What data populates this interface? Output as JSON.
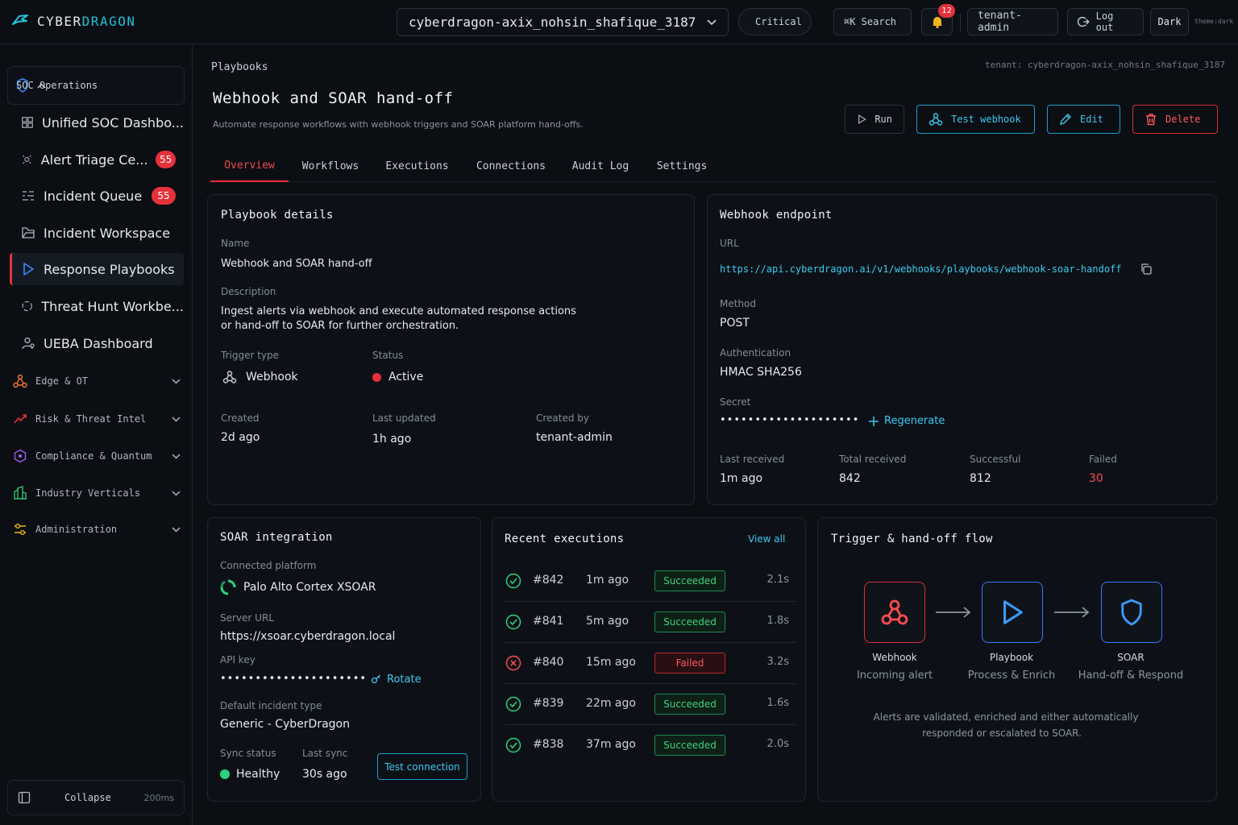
{
  "brand": {
    "name_a": "CYBER",
    "name_b": "DRAGON"
  },
  "topbar": {
    "tenant": "cyberdragon-axix_nohsin_shafique_3187",
    "severity": "Critical",
    "search": "⌘K Search",
    "notifications": "12",
    "user": "tenant-admin",
    "logout": "Log out",
    "theme": "Dark",
    "theme_note": "theme:dark"
  },
  "sidebar": {
    "section": "SOC Operations",
    "items": [
      {
        "label": "Unified SOC Dashbo...",
        "icon": "grid-icon"
      },
      {
        "label": "Alert Triage Ce...",
        "icon": "radar-icon",
        "badge": "55"
      },
      {
        "label": "Incident Queue",
        "icon": "list-icon",
        "badge": "55"
      },
      {
        "label": "Incident Workspace",
        "icon": "folder-icon"
      },
      {
        "label": "Response Playbooks",
        "icon": "play-icon"
      },
      {
        "label": "Threat Hunt Workbe...",
        "icon": "crosshair-icon"
      },
      {
        "label": "UEBA Dashboard",
        "icon": "user-icon"
      }
    ],
    "groups": [
      "Edge & OT",
      "Risk & Threat Intel",
      "Compliance & Quantum",
      "Industry Verticals",
      "Administration"
    ],
    "collapse": "Collapse",
    "collapse_time": "200ms"
  },
  "page": {
    "breadcrumb": "Playbooks",
    "tenant_note": "tenant: cyberdragon-axix_nohsin_shafique_3187",
    "title": "Webhook and SOAR hand-off",
    "subtitle": "Automate response workflows with webhook triggers and SOAR platform hand-offs.",
    "actions": {
      "run": "Run",
      "test": "Test webhook",
      "edit": "Edit",
      "delete": "Delete"
    },
    "tabs": [
      "Overview",
      "Workflows",
      "Executions",
      "Connections",
      "Audit Log",
      "Settings"
    ]
  },
  "details": {
    "title": "Playbook details",
    "name_label": "Name",
    "name": "Webhook and SOAR hand-off",
    "desc_label": "Description",
    "desc_1": "Ingest alerts via webhook and execute automated response actions",
    "desc_2": "or hand-off to SOAR for further orchestration.",
    "trigger_label": "Trigger type",
    "trigger": "Webhook",
    "status_label": "Status",
    "status": "Active",
    "created_label": "Created",
    "created": "2d ago",
    "updated_label": "Last updated",
    "updated": "1h ago",
    "by_label": "Created by",
    "by": "tenant-admin"
  },
  "webhook": {
    "title": "Webhook endpoint",
    "url_label": "URL",
    "url": "https://api.cyberdragon.ai/v1/webhooks/playbooks/webhook-soar-handoff",
    "method_label": "Method",
    "method": "POST",
    "auth_label": "Authentication",
    "auth": "HMAC SHA256",
    "secret_label": "Secret",
    "secret": "••••••••••••••••••••",
    "regenerate": "Regenerate",
    "last_label": "Last received",
    "last": "1m ago",
    "total_label": "Total received",
    "total": "842",
    "success_label": "Successful",
    "success": "812",
    "failed_label": "Failed",
    "failed": "30"
  },
  "soar": {
    "title": "SOAR integration",
    "platform_label": "Connected platform",
    "platform": "Palo Alto Cortex XSOAR",
    "server_label": "Server URL",
    "server": "https://xsoar.cyberdragon.local",
    "key_label": "API key",
    "key": "•••••••••••••••••••••",
    "rotate": "Rotate",
    "incident_label": "Default incident type",
    "incident": "Generic - CyberDragon",
    "sync_label": "Sync status",
    "sync": "Healthy",
    "lastsync_label": "Last sync",
    "lastsync": "30s ago",
    "test": "Test connection"
  },
  "executions": {
    "title": "Recent executions",
    "view_all": "View all",
    "rows": [
      {
        "id": "#842",
        "time": "1m ago",
        "status": "Succeeded",
        "dur": "2.1s",
        "ok": true
      },
      {
        "id": "#841",
        "time": "5m ago",
        "status": "Succeeded",
        "dur": "1.8s",
        "ok": true
      },
      {
        "id": "#840",
        "time": "15m ago",
        "status": "Failed",
        "dur": "3.2s",
        "ok": false
      },
      {
        "id": "#839",
        "time": "22m ago",
        "status": "Succeeded",
        "dur": "1.6s",
        "ok": true
      },
      {
        "id": "#838",
        "time": "37m ago",
        "status": "Succeeded",
        "dur": "2.0s",
        "ok": true
      }
    ]
  },
  "flow": {
    "title": "Trigger & hand-off flow",
    "steps": [
      {
        "name": "Webhook",
        "sub": "Incoming alert"
      },
      {
        "name": "Playbook",
        "sub": "Process & Enrich"
      },
      {
        "name": "SOAR",
        "sub": "Hand-off & Respond"
      }
    ],
    "note_1": "Alerts are validated, enriched and either automatically",
    "note_2": "responded or escalated to SOAR."
  }
}
